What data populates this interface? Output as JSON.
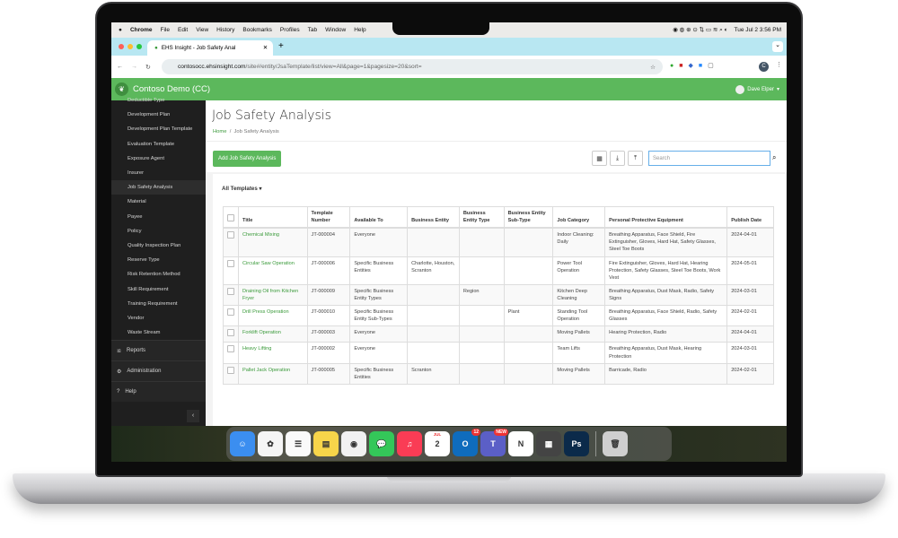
{
  "menubar": {
    "app": "Chrome",
    "items": [
      "File",
      "Edit",
      "View",
      "History",
      "Bookmarks",
      "Profiles",
      "Tab",
      "Window",
      "Help"
    ],
    "datetime": "Tue Jul 2  3:56 PM"
  },
  "browser": {
    "tab_title": "EHS Insight - Job Safety Anal",
    "url_host": "contosocc.ehsinsight.com",
    "url_path": "/site#/entity/JsaTemplate/list/view=All&page=1&pagesize=20&sort=",
    "profile_initial": "C"
  },
  "app": {
    "name": "Contoso Demo (CC)",
    "user": "Dave Elper"
  },
  "sidebar": {
    "items": [
      "Deductible Type",
      "Development Plan",
      "Development Plan Template",
      "Evaluation Template",
      "Exposure Agent",
      "Insurer",
      "Job Safety Analysis",
      "Material",
      "Payee",
      "Policy",
      "Quality Inspection Plan",
      "Reserve Type",
      "Risk Retention Method",
      "Skill Requirement",
      "Training Requirement",
      "Vendor",
      "Waste Stream"
    ],
    "active": "Job Safety Analysis",
    "sections": [
      "Reports",
      "Administration",
      "Help"
    ]
  },
  "page": {
    "title": "Job Safety Analysis",
    "breadcrumb": [
      "Home",
      "Job Safety Analysis"
    ],
    "add_button": "Add Job Safety Analysis",
    "search_placeholder": "Search",
    "filter": "All Templates"
  },
  "table": {
    "headers": [
      "Title",
      "Template Number",
      "Available To",
      "Business Entity",
      "Business Entity Type",
      "Business Entity Sub-Type",
      "Job Category",
      "Personal Protective Equipment",
      "Publish Date"
    ],
    "rows": [
      [
        "Chemical Mixing",
        "JT-000004",
        "Everyone",
        "",
        "",
        "",
        "Indoor Cleaning: Daily",
        "Breathing Apparatus, Face Shield, Fire Extinguisher, Gloves, Hard Hat, Safety Glasses, Steel Toe Boots",
        "2024-04-01"
      ],
      [
        "Circular Saw Operation",
        "JT-000006",
        "Specific Business Entities",
        "Charlotte, Houston, Scranton",
        "",
        "",
        "Power Tool Operation",
        "Fire Extinguisher, Gloves, Hard Hat, Hearing Protection, Safety Glasses, Steel Toe Boots, Work Vest",
        "2024-05-01"
      ],
      [
        "Draining Oil from Kitchen Fryer",
        "JT-000009",
        "Specific Business Entity Types",
        "",
        "Region",
        "",
        "Kitchen Deep Cleaning",
        "Breathing Apparatus, Dust Mask, Radio, Safety Signs",
        "2024-03-01"
      ],
      [
        "Drill Press Operation",
        "JT-000010",
        "Specific Business Entity Sub-Types",
        "",
        "",
        "Plant",
        "Standing Tool Operation",
        "Breathing Apparatus, Face Shield, Radio, Safety Glasses",
        "2024-02-01"
      ],
      [
        "Forklift Operation",
        "JT-000003",
        "Everyone",
        "",
        "",
        "",
        "Moving Pallets",
        "Hearing Protection, Radio",
        "2024-04-01"
      ],
      [
        "Heavy Lifting",
        "JT-000002",
        "Everyone",
        "",
        "",
        "",
        "Team Lifts",
        "Breathing Apparatus, Dust Mask, Hearing Protection",
        "2024-03-01"
      ],
      [
        "Pallet Jack Operation",
        "JT-000005",
        "Specific Business Entities",
        "Scranton",
        "",
        "",
        "Moving Pallets",
        "Barricade, Radio",
        "2024-02-01"
      ]
    ]
  },
  "dock": {
    "items": [
      {
        "name": "Finder",
        "icon": "finder-icon",
        "color": "#3b8ef0",
        "glyph": "☺"
      },
      {
        "name": "Photos",
        "icon": "photos-icon",
        "color": "#f5f5f5",
        "glyph": "✿"
      },
      {
        "name": "Reminders",
        "icon": "reminders-icon",
        "color": "#fafafa",
        "glyph": "☰"
      },
      {
        "name": "Notes",
        "icon": "notes-icon",
        "color": "#f7d54a",
        "glyph": "▤"
      },
      {
        "name": "Chrome",
        "icon": "chrome-icon",
        "color": "#f1f1f1",
        "glyph": "◉"
      },
      {
        "name": "Messages",
        "icon": "messages-icon",
        "color": "#34c759",
        "glyph": "💬"
      },
      {
        "name": "Music",
        "icon": "music-icon",
        "color": "#fa3c55",
        "glyph": "♫"
      },
      {
        "name": "Calendar",
        "icon": "calendar-icon",
        "color": "#ffffff",
        "glyph": "2",
        "month": "JUL"
      },
      {
        "name": "Outlook",
        "icon": "outlook-icon",
        "color": "#0f6cbd",
        "glyph": "O",
        "badge": "12"
      },
      {
        "name": "Teams",
        "icon": "teams-icon",
        "color": "#5b5fc7",
        "glyph": "T",
        "badge": "NEW"
      },
      {
        "name": "Notion",
        "icon": "notion-icon",
        "color": "#ffffff",
        "glyph": "N"
      },
      {
        "name": "Calculator",
        "icon": "calculator-icon",
        "color": "#444444",
        "glyph": "▦"
      },
      {
        "name": "Photoshop",
        "icon": "photoshop-icon",
        "color": "#0b2a4a",
        "glyph": "Ps"
      },
      {
        "name": "Trash",
        "icon": "trash-icon",
        "color": "#cfcfcf",
        "glyph": "🗑"
      }
    ]
  },
  "colors": {
    "brand_green": "#5cb85c",
    "link_green": "#3a9a3a",
    "sidebar_bg": "#1f1f1f",
    "tabbar": "#b8e7f2"
  }
}
